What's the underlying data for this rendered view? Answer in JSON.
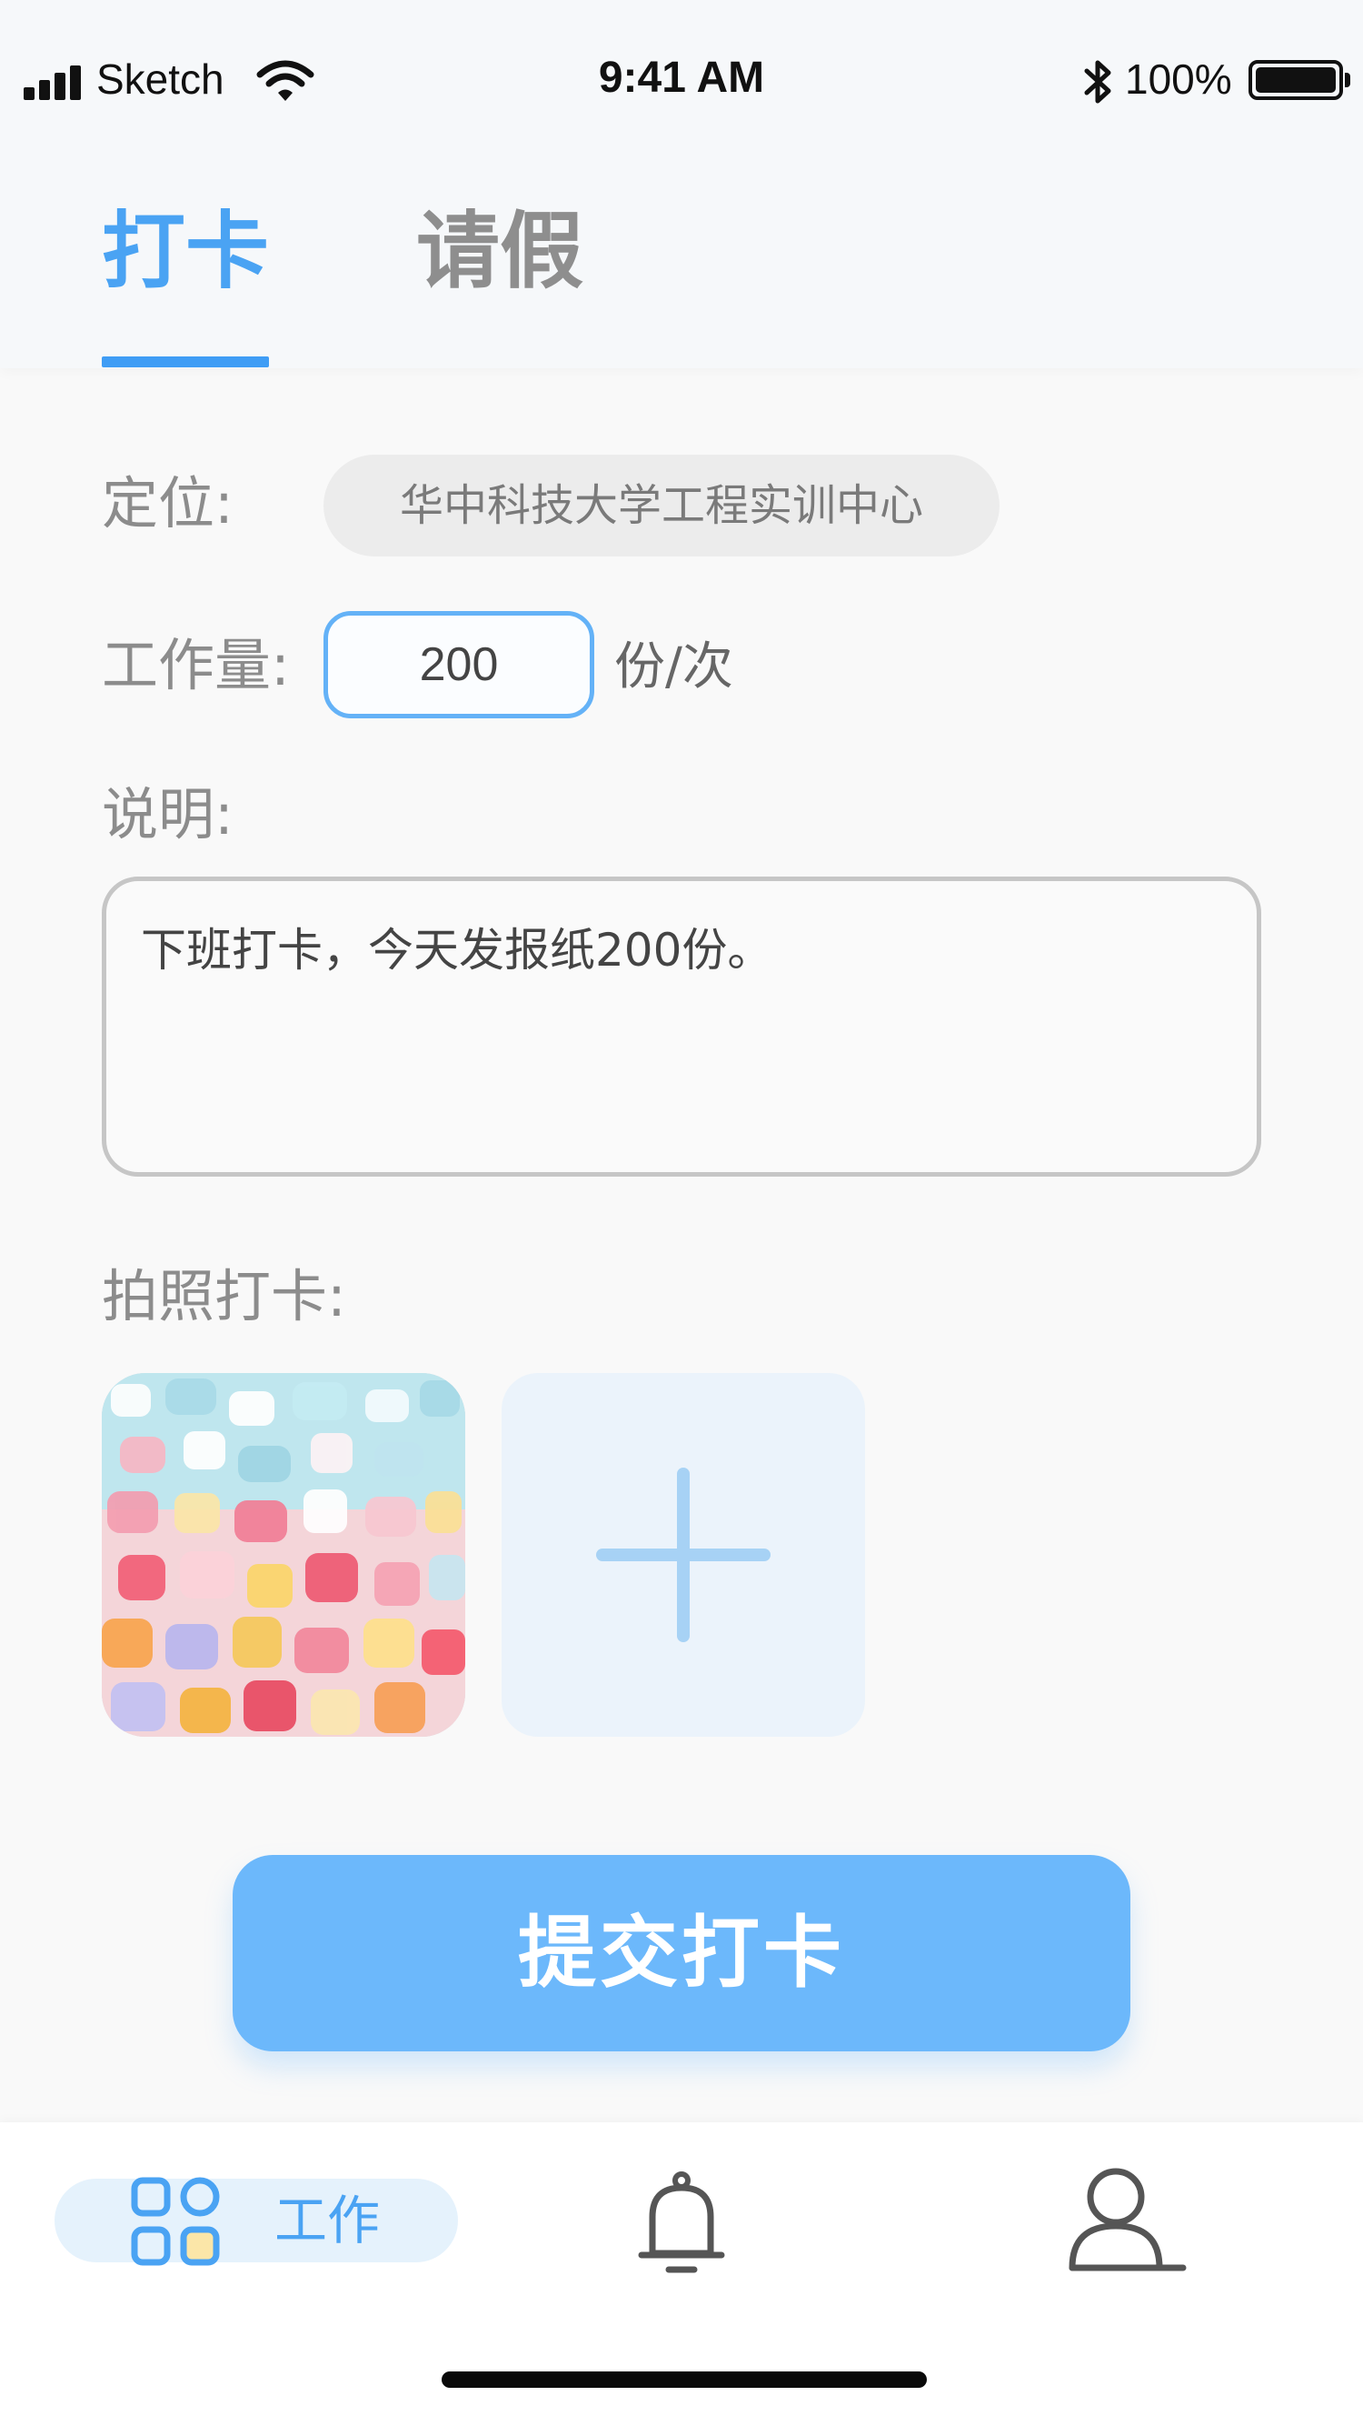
{
  "status_bar": {
    "carrier": "Sketch",
    "time": "9:41 AM",
    "battery": "100%",
    "icons": [
      "signal-icon",
      "wifi-icon",
      "bluetooth-icon",
      "battery-icon"
    ]
  },
  "tabs": [
    {
      "label": "打卡",
      "active": true
    },
    {
      "label": "请假",
      "active": false
    }
  ],
  "form": {
    "location_label": "定位:",
    "location_value": "华中科技大学工程实训中心",
    "workload_label": "工作量:",
    "workload_value": "200",
    "workload_unit": "份/次",
    "description_label": "说明:",
    "description_value": "下班打卡，今天发报纸200份。",
    "photo_label": "拍照打卡:",
    "photos": [
      {
        "kind": "image",
        "icon": "photo-thumbnail"
      }
    ],
    "add_photo_icon": "plus-icon"
  },
  "submit_label": "提交打卡",
  "bottom_nav": {
    "items": [
      {
        "label": "工作",
        "icon": "grid-icon",
        "active": true
      },
      {
        "label": "",
        "icon": "bell-icon",
        "active": false
      },
      {
        "label": "",
        "icon": "user-icon",
        "active": false
      }
    ]
  },
  "colors": {
    "accent": "#4aa3f3",
    "button": "#6cb8fb",
    "background": "#f9f9f9"
  }
}
